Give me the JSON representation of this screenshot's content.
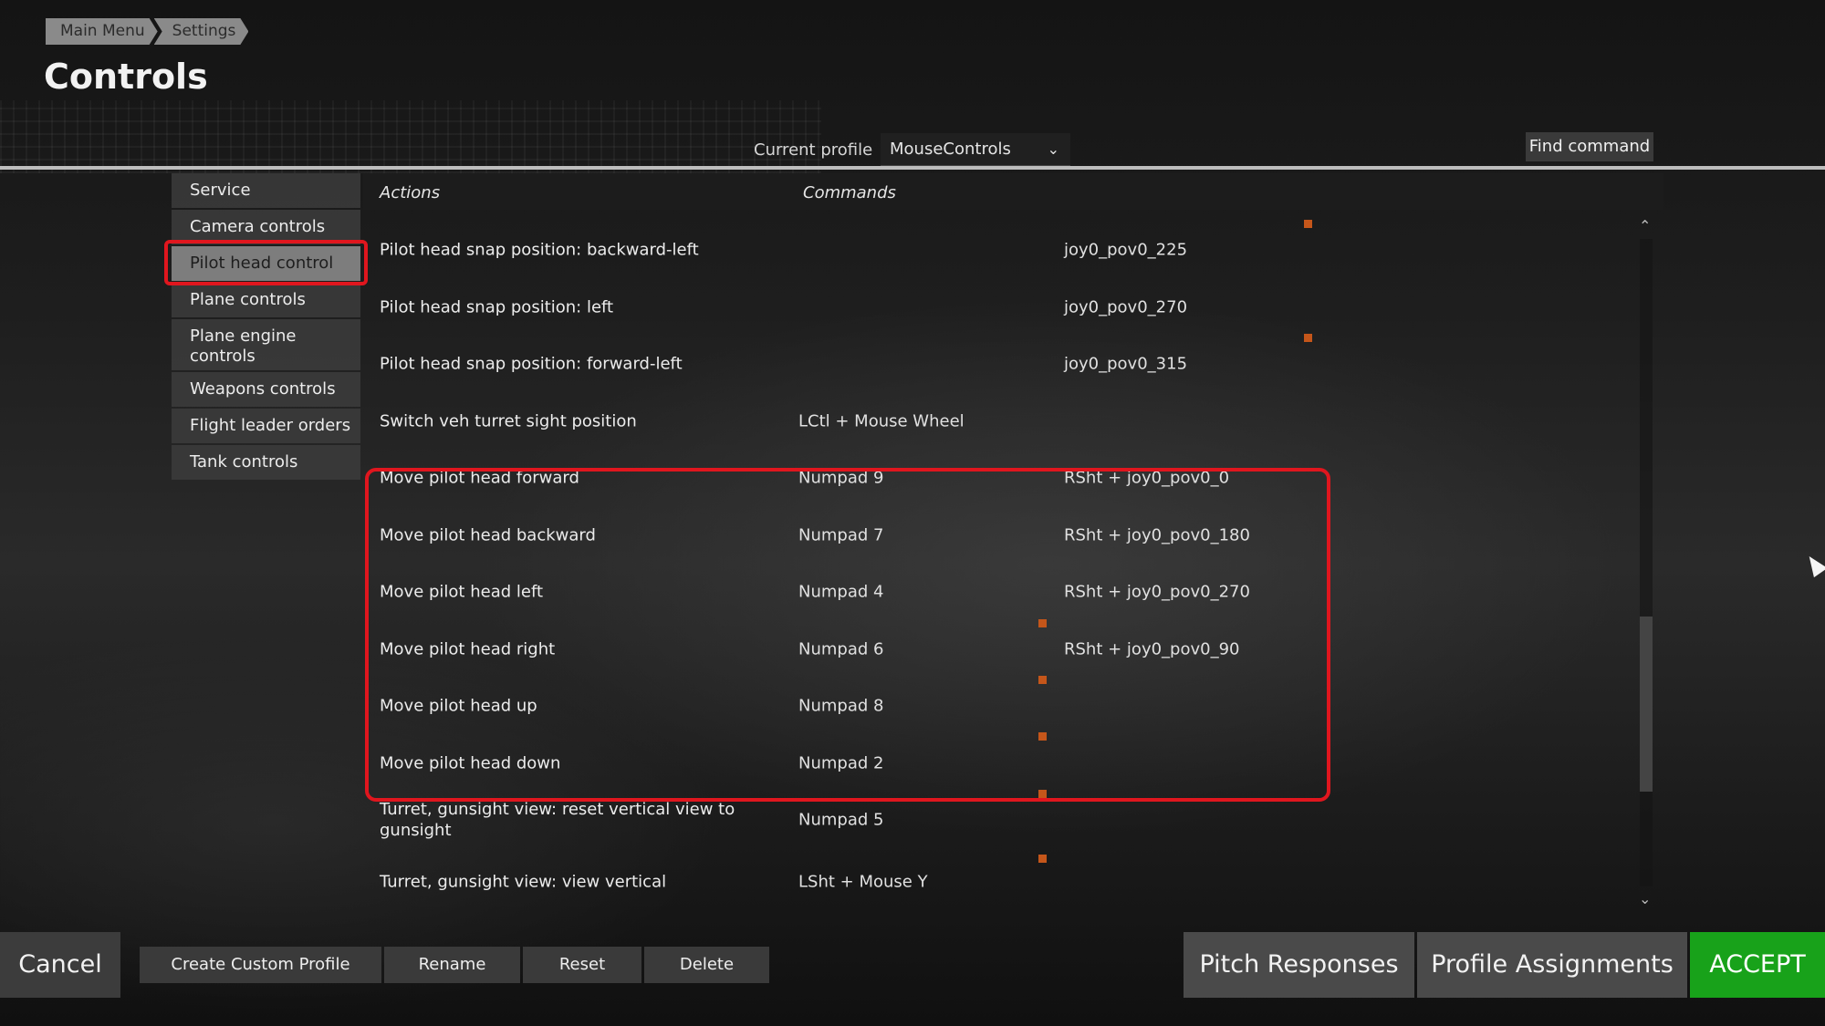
{
  "breadcrumb": [
    "Main Menu",
    "Settings"
  ],
  "title": "Controls",
  "profile": {
    "label": "Current profile",
    "value": "MouseControls"
  },
  "find_command": "Find command",
  "categories": [
    "Service",
    "Camera controls",
    "Pilot head control",
    "Plane controls",
    "Plane engine controls",
    "Weapons controls",
    "Flight leader orders",
    "Tank controls"
  ],
  "columns": {
    "actions": "Actions",
    "commands": "Commands"
  },
  "rows": [
    {
      "action": "Pilot head snap position: backward-left",
      "cmd1": "",
      "cmd2": "joy0_pov0_225"
    },
    {
      "action": "Pilot head snap position: left",
      "cmd1": "",
      "cmd2": "joy0_pov0_270"
    },
    {
      "action": "Pilot head snap position: forward-left",
      "cmd1": "",
      "cmd2": "joy0_pov0_315"
    },
    {
      "action": "Switch veh turret sight position",
      "cmd1": "LCtl + Mouse Wheel",
      "cmd2": ""
    },
    {
      "action": "Move pilot head forward",
      "cmd1": "Numpad 9",
      "cmd2": "RSht + joy0_pov0_0"
    },
    {
      "action": "Move pilot head backward",
      "cmd1": "Numpad 7",
      "cmd2": "RSht + joy0_pov0_180"
    },
    {
      "action": "Move pilot head left",
      "cmd1": "Numpad 4",
      "cmd2": "RSht + joy0_pov0_270"
    },
    {
      "action": "Move pilot head right",
      "cmd1": "Numpad 6",
      "cmd2": "RSht + joy0_pov0_90"
    },
    {
      "action": "Move pilot head up",
      "cmd1": "Numpad 8",
      "cmd2": ""
    },
    {
      "action": "Move pilot head down",
      "cmd1": "Numpad 2",
      "cmd2": ""
    },
    {
      "action": "Turret, gunsight view: reset vertical view to gunsight",
      "cmd1": "Numpad 5",
      "cmd2": ""
    },
    {
      "action": "Turret, gunsight view: view vertical",
      "cmd1": "LSht + Mouse Y",
      "cmd2": ""
    }
  ],
  "bottom": {
    "cancel": "Cancel",
    "create": "Create Custom Profile",
    "rename": "Rename",
    "reset": "Reset",
    "delete": "Delete",
    "pitch": "Pitch Responses",
    "assign": "Profile Assignments",
    "accept": "ACCEPT"
  },
  "colors": {
    "highlight": "#e0161e",
    "accept": "#18a21a",
    "marker": "#c5561a"
  }
}
